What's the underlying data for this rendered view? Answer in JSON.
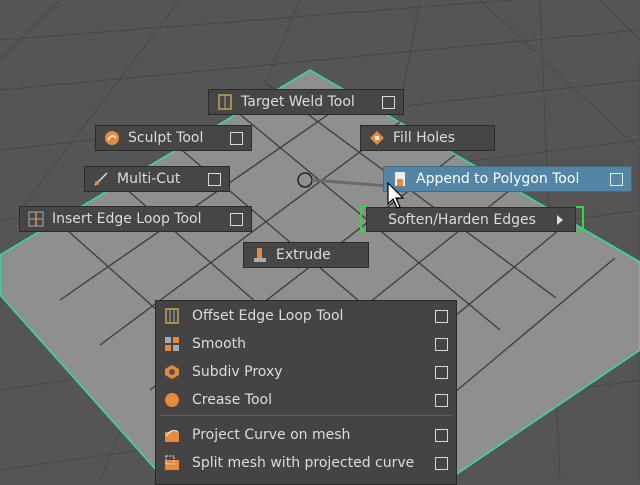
{
  "marking_menu": {
    "target_weld": {
      "label": "Target Weld Tool",
      "icon": "target-weld-icon"
    },
    "sculpt": {
      "label": "Sculpt Tool",
      "icon": "sculpt-icon"
    },
    "fill_holes": {
      "label": "Fill Holes",
      "icon": "fill-holes-icon"
    },
    "multi_cut": {
      "label": "Multi-Cut",
      "icon": "multi-cut-icon"
    },
    "append_polygon": {
      "label": "Append to Polygon Tool",
      "icon": "append-polygon-icon"
    },
    "insert_edge_loop": {
      "label": "Insert Edge Loop Tool",
      "icon": "insert-edge-loop-icon"
    },
    "soften_harden": {
      "label": "Soften/Harden Edges",
      "icon": "submenu-arrow-icon"
    },
    "extrude": {
      "label": "Extrude",
      "icon": "extrude-icon"
    }
  },
  "overflow_menu": {
    "items": [
      {
        "label": "Offset Edge Loop Tool",
        "icon": "offset-edge-loop-icon"
      },
      {
        "label": "Smooth",
        "icon": "smooth-icon"
      },
      {
        "label": "Subdiv Proxy",
        "icon": "subdiv-proxy-icon"
      },
      {
        "label": "Crease Tool",
        "icon": "crease-tool-icon"
      },
      {
        "label": "Project Curve on mesh",
        "icon": "project-curve-icon"
      },
      {
        "label": "Split mesh with projected curve",
        "icon": "split-mesh-icon"
      }
    ]
  },
  "colors": {
    "highlight": "#5285a6",
    "mesh_edge": "#2ee0a0",
    "bracket": "#23e03a"
  }
}
